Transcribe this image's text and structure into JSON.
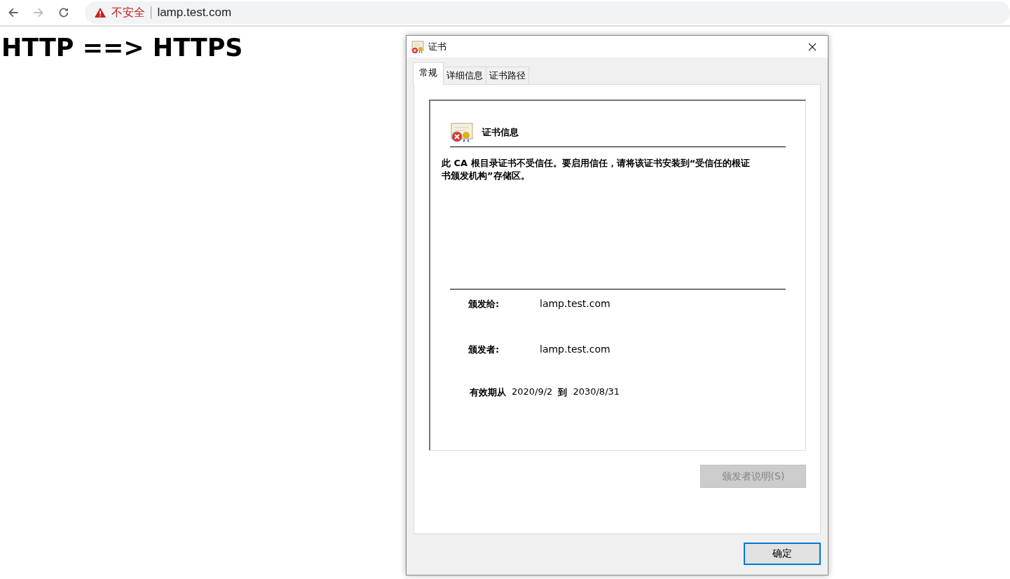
{
  "browser": {
    "back_disabled": false,
    "forward_disabled": true,
    "security_label": "不安全",
    "url": "lamp.test.com"
  },
  "page": {
    "heading": "HTTP ==> HTTPS"
  },
  "dialog": {
    "title": "证书",
    "tabs": [
      {
        "label": "常规",
        "selected": true
      },
      {
        "label": "详细信息",
        "selected": false
      },
      {
        "label": "证书路径",
        "selected": false
      }
    ],
    "info_title": "证书信息",
    "warning": "此 CA 根目录证书不受信任。要启用信任，请将该证书安装到“受信任的根证书颁发机构”存储区。",
    "fields": [
      {
        "label": "颁发给:",
        "value": "lamp.test.com"
      },
      {
        "label": "颁发者:",
        "value": "lamp.test.com"
      }
    ],
    "validity": {
      "from_label": "有效期从",
      "from": "2020/9/2",
      "to_label": "到",
      "to": "2030/8/31"
    },
    "issuer_statement_button": {
      "label": "颁发者说明(S)",
      "disabled": true
    },
    "ok_button": {
      "label": "确定"
    }
  }
}
